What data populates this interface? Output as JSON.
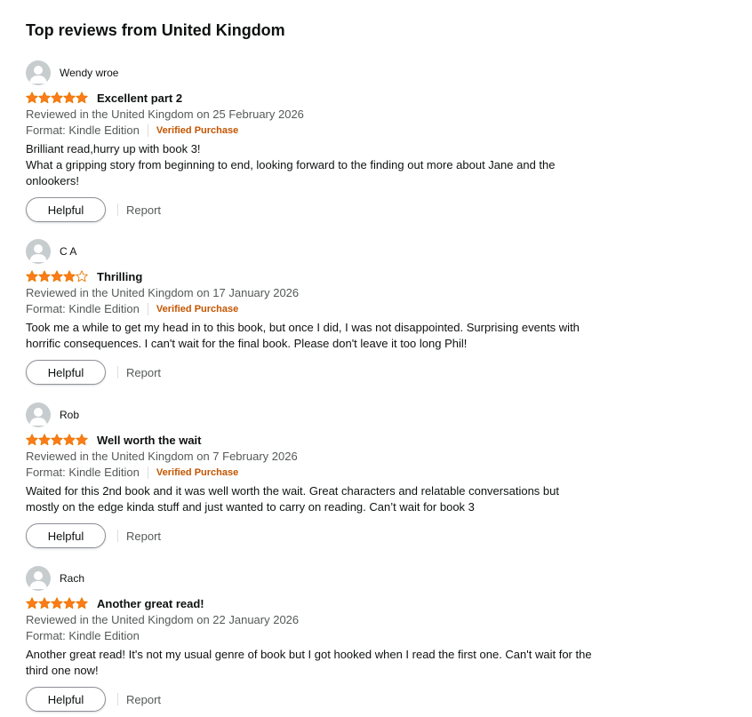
{
  "heading": "Top reviews from United Kingdom",
  "colors": {
    "star": "#ff7a1a",
    "star_empty": "#ffffff",
    "star_outline": "#e67a00",
    "verified": "#c45500",
    "meta": "#565959",
    "text": "#0f1111"
  },
  "reviews": [
    {
      "profile_name": "Wendy wroe",
      "rating": 5,
      "title": "Excellent part 2",
      "date_line": "Reviewed in the United Kingdom on 25 February 2026",
      "format": "Format: Kindle Edition",
      "verified": "Verified Purchase",
      "body": [
        "Brilliant read,hurry up with book 3!",
        "What a gripping story from beginning to end, looking forward to the finding out more about Jane and the onlookers!"
      ],
      "helpful_label": "Helpful",
      "report_label": "Report"
    },
    {
      "profile_name": "C A",
      "rating": 4,
      "title": "Thrilling",
      "date_line": "Reviewed in the United Kingdom on 17 January 2026",
      "format": "Format: Kindle Edition",
      "verified": "Verified Purchase",
      "body": [
        "Took me a while to get my head in to this book, but once I did, I was not disappointed. Surprising events with horrific consequences. I can't wait for the final book. Please don't leave it too long Phil!"
      ],
      "helpful_label": "Helpful",
      "report_label": "Report"
    },
    {
      "profile_name": "Rob",
      "rating": 5,
      "title": "Well worth the wait",
      "date_line": "Reviewed in the United Kingdom on 7 February 2026",
      "format": "Format: Kindle Edition",
      "verified": "Verified Purchase",
      "body": [
        "Waited for this 2nd book and it was well worth the wait. Great characters and relatable conversations but mostly on the edge kinda stuff and just wanted to carry on reading. Can’t wait for book 3"
      ],
      "helpful_label": "Helpful",
      "report_label": "Report"
    },
    {
      "profile_name": "Rach",
      "rating": 5,
      "title": "Another great read!",
      "date_line": "Reviewed in the United Kingdom on 22 January 2026",
      "format": "Format: Kindle Edition",
      "verified": "",
      "body": [
        "Another great read! It's not my usual genre of book but I got hooked when I read the first one. Can't wait for the third one now!"
      ],
      "helpful_label": "Helpful",
      "report_label": "Report"
    }
  ]
}
